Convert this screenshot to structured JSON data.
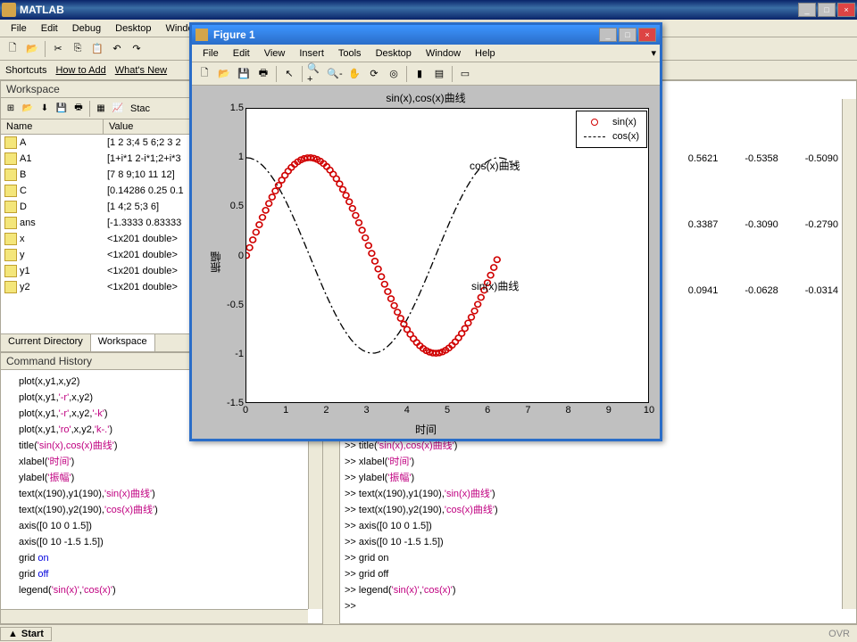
{
  "app": {
    "title": "MATLAB"
  },
  "main_menu": [
    "File",
    "Edit",
    "Debug",
    "Desktop",
    "Window"
  ],
  "shortcuts": {
    "label": "Shortcuts",
    "items": [
      "How to Add",
      "What's New"
    ]
  },
  "workspace": {
    "title": "Workspace",
    "stack_label": "Stac",
    "cols": {
      "name": "Name",
      "value": "Value"
    },
    "vars": [
      {
        "name": "A",
        "value": "[1 2 3;4 5 6;2 3 2"
      },
      {
        "name": "A1",
        "value": "[1+i*1 2-i*1;2+i*3"
      },
      {
        "name": "B",
        "value": "[7 8 9;10 11 12]"
      },
      {
        "name": "C",
        "value": "[0.14286 0.25 0.1"
      },
      {
        "name": "D",
        "value": "[1 4;2 5;3 6]"
      },
      {
        "name": "ans",
        "value": "[-1.3333 0.83333"
      },
      {
        "name": "x",
        "value": "<1x201 double>"
      },
      {
        "name": "y",
        "value": "<1x201 double>"
      },
      {
        "name": "y1",
        "value": "<1x201 double>"
      },
      {
        "name": "y2",
        "value": "<1x201 double>"
      }
    ],
    "tabs": {
      "current_dir": "Current Directory",
      "workspace": "Workspace"
    }
  },
  "cmd_history": {
    "title": "Command History",
    "lines": [
      {
        "pre": "plot(x,y1,x,y2)",
        "str": "",
        "post": ""
      },
      {
        "pre": "plot(x,y1,",
        "str": "'-r'",
        "post": ",x,y2)"
      },
      {
        "pre": "plot(x,y1,",
        "str": "'-r'",
        "post": ",x,y2,",
        "str2": "'-k'",
        "post2": ")"
      },
      {
        "pre": "plot(x,y1,",
        "str": "'ro'",
        "post": ",x,y2,",
        "str2": "'k-.'",
        "post2": ")"
      },
      {
        "pre": "title(",
        "str": "'sin(x),cos(x)曲线'",
        "post": ")"
      },
      {
        "pre": "xlabel(",
        "str": "'时间'",
        "post": ")"
      },
      {
        "pre": "ylabel(",
        "str": "'振幅'",
        "post": ")"
      },
      {
        "pre": "text(x(190),y1(190),",
        "str": "'sin(x)曲线'",
        "post": ")"
      },
      {
        "pre": "text(x(190),y2(190),",
        "str": "'cos(x)曲线'",
        "post": ")"
      },
      {
        "pre": "axis([0 10 0 1.5])",
        "str": "",
        "post": ""
      },
      {
        "pre": "axis([0 10 -1.5 1.5])",
        "str": "",
        "post": ""
      },
      {
        "pre": "grid ",
        "kw": "on",
        "post": ""
      },
      {
        "pre": "grid ",
        "kw": "off",
        "post": ""
      },
      {
        "pre": "legend(",
        "str": "'sin(x)'",
        "post": ",",
        "str2": "'cos(x)'",
        "post2": ")"
      }
    ]
  },
  "cmd_window": {
    "numeric_rows": [
      [
        "0.5621",
        "-0.5358",
        "-0.5090"
      ],
      [
        "0.3387",
        "-0.3090",
        "-0.2790"
      ],
      [
        "0.0941",
        "-0.0628",
        "-0.0314"
      ]
    ],
    "lines": [
      {
        "prompt": ">> ",
        "pre": "title(",
        "str": "'sin(x),cos(x)曲线'",
        "post": ")"
      },
      {
        "prompt": ">> ",
        "pre": "xlabel(",
        "str": "'时间'",
        "post": ")"
      },
      {
        "prompt": ">> ",
        "pre": "ylabel(",
        "str": "'振幅'",
        "post": ")"
      },
      {
        "prompt": ">> ",
        "pre": "text(x(190),y1(190),",
        "str": "'sin(x)曲线'",
        "post": ")"
      },
      {
        "prompt": ">> ",
        "pre": "text(x(190),y2(190),",
        "str": "'cos(x)曲线'",
        "post": ")"
      },
      {
        "prompt": ">> ",
        "pre": "axis([0 10 0 1.5])",
        "str": "",
        "post": ""
      },
      {
        "prompt": ">> ",
        "pre": "axis([0 10 -1.5 1.5])",
        "str": "",
        "post": ""
      },
      {
        "prompt": ">> ",
        "pre": "grid on",
        "str": "",
        "post": ""
      },
      {
        "prompt": ">> ",
        "pre": "grid off",
        "str": "",
        "post": ""
      },
      {
        "prompt": ">> ",
        "pre": "legend(",
        "str": "'sin(x)'",
        "post": ",",
        "str2": "'cos(x)'",
        "post2": ")"
      },
      {
        "prompt": ">> ",
        "pre": "",
        "str": "",
        "post": ""
      }
    ]
  },
  "figure": {
    "title": "Figure 1",
    "menu": [
      "File",
      "Edit",
      "View",
      "Insert",
      "Tools",
      "Desktop",
      "Window",
      "Help"
    ],
    "plot_title": "sin(x),cos(x)曲线",
    "xlabel": "时间",
    "ylabel": "振幅",
    "legend": {
      "s1": "sin(x)",
      "s2": "cos(x)"
    },
    "ann": {
      "sin": "sin(x)曲线",
      "cos": "cos(x)曲线"
    }
  },
  "start": {
    "label": "Start"
  },
  "status_right": "OVR",
  "chart_data": {
    "type": "line",
    "title": "sin(x),cos(x)曲线",
    "xlabel": "时间",
    "ylabel": "振幅",
    "xlim": [
      0,
      10
    ],
    "ylim": [
      -1.5,
      1.5
    ],
    "xticks": [
      0,
      1,
      2,
      3,
      4,
      5,
      6,
      7,
      8,
      9,
      10
    ],
    "yticks": [
      -1.5,
      -1,
      -0.5,
      0,
      0.5,
      1,
      1.5
    ],
    "series": [
      {
        "name": "sin(x)",
        "style": "ro",
        "color": "#d00000",
        "x_formula": "0..10 step 0.05",
        "y_formula": "sin(x)"
      },
      {
        "name": "cos(x)",
        "style": "k-.",
        "color": "#000000",
        "x_formula": "0..10 step 0.05",
        "y_formula": "cos(x)"
      }
    ],
    "annotations": [
      {
        "text": "sin(x)曲线",
        "x": 5.5,
        "y": -0.7
      },
      {
        "text": "cos(x)曲线",
        "x": 5.5,
        "y": 0.7
      }
    ],
    "legend_position": "northeast",
    "grid": false
  }
}
